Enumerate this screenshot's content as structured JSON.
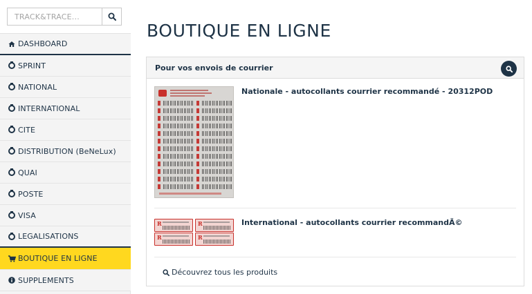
{
  "search": {
    "placeholder": "TRACK&TRACE..."
  },
  "sidebar": {
    "items": [
      {
        "label": "DASHBOARD",
        "icon": "home-icon"
      },
      {
        "label": "SPRINT",
        "icon": "ring-icon"
      },
      {
        "label": "NATIONAL",
        "icon": "ring-icon"
      },
      {
        "label": "INTERNATIONAL",
        "icon": "ring-icon"
      },
      {
        "label": "CITE",
        "icon": "ring-icon"
      },
      {
        "label": "DISTRIBUTION (BeNeLux)",
        "icon": "ring-icon"
      },
      {
        "label": "QUAI",
        "icon": "ring-icon"
      },
      {
        "label": "POSTE",
        "icon": "ring-icon"
      },
      {
        "label": "VISA",
        "icon": "ring-icon"
      },
      {
        "label": "LEGALISATIONS",
        "icon": "ring-icon"
      },
      {
        "label": "BOUTIQUE EN LIGNE",
        "icon": "cart-icon"
      },
      {
        "label": "SUPPLEMENTS",
        "icon": "info-icon"
      }
    ],
    "active_index": 10
  },
  "main": {
    "title": "BOUTIQUE EN LIGNE",
    "panel": {
      "title": "Pour vos envois de courrier",
      "products": [
        {
          "name": "Nationale - autocollants courrier recommandé - 20312POD"
        },
        {
          "name": "International - autocollants courrier recommandÃ©"
        }
      ],
      "discover_label": "Découvrez tous les produits"
    }
  },
  "colors": {
    "navy": "#1e3346",
    "active": "#ffd81f",
    "sidebar_bg": "#f4f4f4",
    "label_red": "#c8302b"
  }
}
